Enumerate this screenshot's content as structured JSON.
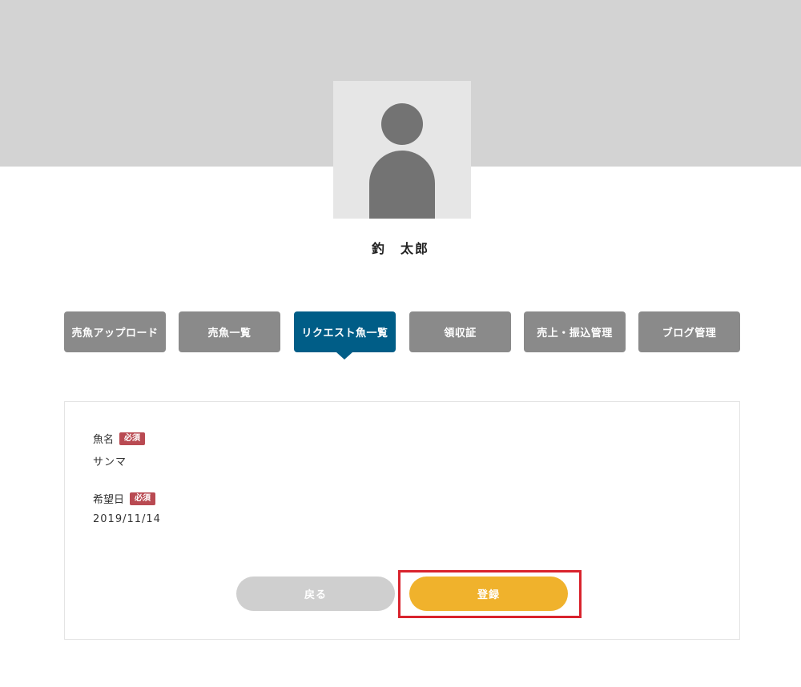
{
  "profile": {
    "name": "釣　太郎"
  },
  "nav": {
    "tabs": [
      {
        "label": "売魚アップロード",
        "active": false
      },
      {
        "label": "売魚一覧",
        "active": false
      },
      {
        "label": "リクエスト魚一覧",
        "active": true
      },
      {
        "label": "領収証",
        "active": false
      },
      {
        "label": "売上・振込管理",
        "active": false
      },
      {
        "label": "ブログ管理",
        "active": false
      }
    ]
  },
  "form": {
    "fields": [
      {
        "label": "魚名",
        "badge": "必須",
        "value": "サンマ"
      },
      {
        "label": "希望日",
        "badge": "必須",
        "value": "2019/11/14"
      }
    ],
    "back_label": "戻る",
    "submit_label": "登録"
  },
  "colors": {
    "header_band": "#d3d3d3",
    "tab_default": "#8a8a8a",
    "tab_active": "#005d87",
    "required_badge": "#b94a52",
    "back_button": "#cfcfcf",
    "submit_button": "#f0b22c",
    "highlight": "#d9232d"
  },
  "icons": {
    "avatar": "user-silhouette-icon"
  }
}
